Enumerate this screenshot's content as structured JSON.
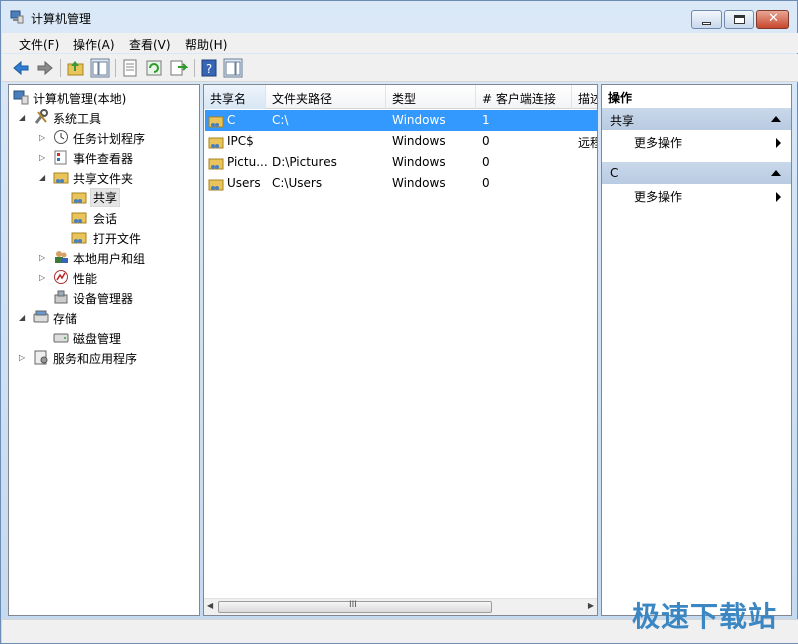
{
  "window": {
    "title": "计算机管理"
  },
  "menu": [
    "文件(F)",
    "操作(A)",
    "查看(V)",
    "帮助(H)"
  ],
  "tree": {
    "root": "计算机管理(本地)",
    "system_tools": "系统工具",
    "task_scheduler": "任务计划程序",
    "event_viewer": "事件查看器",
    "shared_folders": "共享文件夹",
    "shares": "共享",
    "sessions": "会话",
    "open_files": "打开文件",
    "local_users": "本地用户和组",
    "performance": "性能",
    "device_manager": "设备管理器",
    "storage": "存储",
    "disk_management": "磁盘管理",
    "services_apps": "服务和应用程序"
  },
  "table": {
    "columns": [
      "共享名",
      "文件夹路径",
      "类型",
      "# 客户端连接",
      "描述"
    ],
    "rows": [
      {
        "name": "C",
        "path": "C:\\",
        "type": "Windows",
        "clients": "1",
        "desc": ""
      },
      {
        "name": "IPC$",
        "path": "",
        "type": "Windows",
        "clients": "0",
        "desc": "远程"
      },
      {
        "name": "Pictu...",
        "path": "D:\\Pictures",
        "type": "Windows",
        "clients": "0",
        "desc": ""
      },
      {
        "name": "Users",
        "path": "C:\\Users",
        "type": "Windows",
        "clients": "0",
        "desc": ""
      }
    ],
    "scroll_grip": "III"
  },
  "actions": {
    "title": "操作",
    "group1": "共享",
    "group1_more": "更多操作",
    "group2": "C",
    "group2_more": "更多操作"
  },
  "watermark": "极速下载站",
  "colors": {
    "selection": "#3399ff",
    "action_header": "#c9d8ea"
  }
}
